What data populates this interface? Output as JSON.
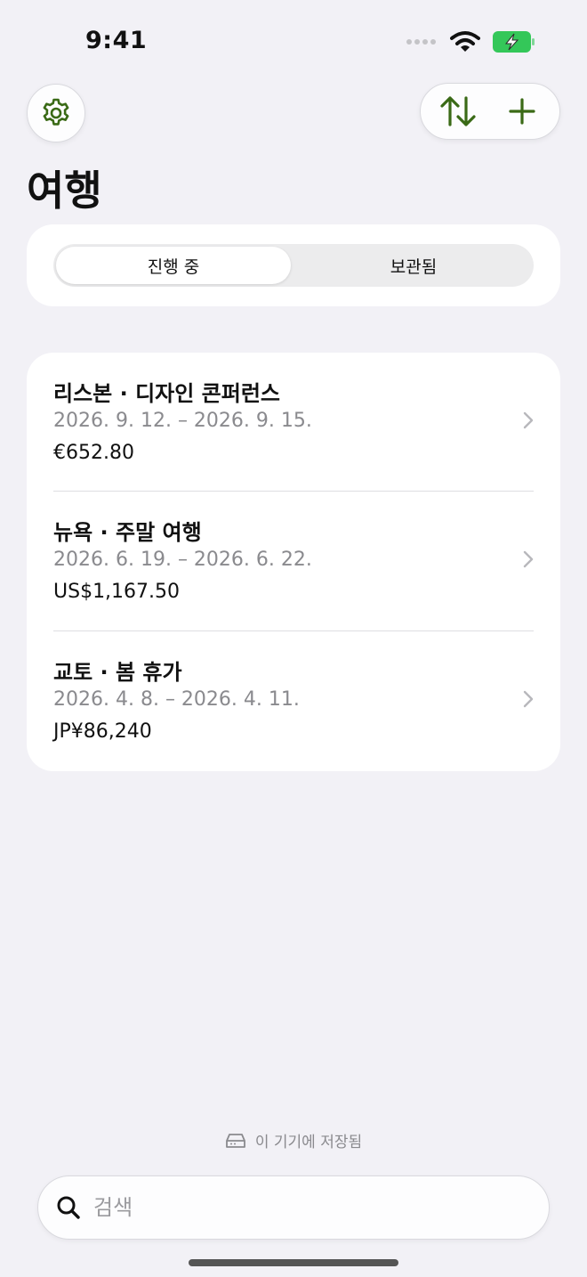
{
  "status_bar": {
    "time": "9:41"
  },
  "header": {
    "title": "여행"
  },
  "segments": {
    "active": "진행 중",
    "inactive": "보관됨"
  },
  "trips": [
    {
      "title": "리스본 · 디자인 콘퍼런스",
      "dates": "2026. 9. 12. – 2026. 9. 15.",
      "amount": "€652.80"
    },
    {
      "title": "뉴욕 · 주말 여행",
      "dates": "2026. 6. 19. – 2026. 6. 22.",
      "amount": "US$1,167.50"
    },
    {
      "title": "교토 · 봄 휴가",
      "dates": "2026. 4. 8. – 2026. 4. 11.",
      "amount": "JP¥86,240"
    }
  ],
  "footer": {
    "storage_note": "이 기기에 저장됨"
  },
  "search": {
    "placeholder": "검색"
  },
  "colors": {
    "accent": "#3a6a16",
    "background": "#f2f1f6",
    "battery": "#34c759"
  }
}
